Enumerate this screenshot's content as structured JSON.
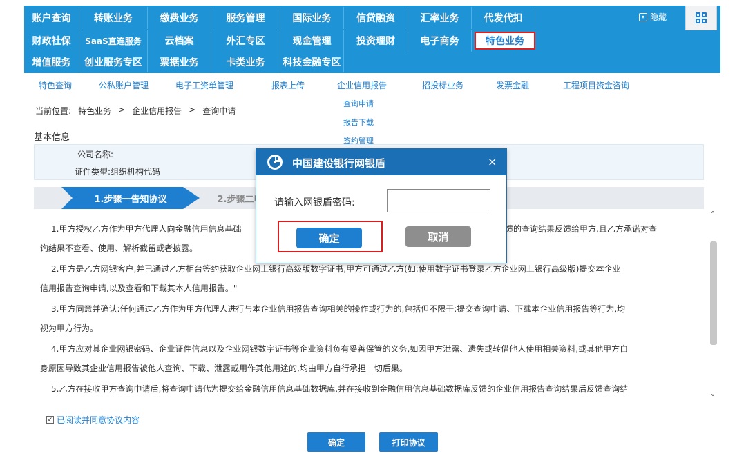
{
  "nav": {
    "row1": [
      "账户查询",
      "转账业务",
      "缴费业务",
      "服务管理",
      "国际业务",
      "信贷融资",
      "汇率业务",
      "代发代扣"
    ],
    "row2": [
      "财政社保",
      "SaaS直连服务",
      "云档案",
      "外汇专区",
      "现金管理",
      "投资理财",
      "电子商务",
      "特色业务"
    ],
    "row3": [
      "增值服务",
      "创业服务专区",
      "票据业务",
      "卡类业务",
      "科技金融专区"
    ],
    "hide_label": "隐藏",
    "hide_icon_glyph": "▾"
  },
  "subnav": {
    "items": [
      "特色查询",
      "公私账户管理",
      "电子工资单管理",
      "报表上传",
      "企业信用报告",
      "招投标业务",
      "发票金融",
      "工程项目资金咨询"
    ],
    "dropdown": [
      "查询申请",
      "报告下载",
      "签约管理"
    ]
  },
  "breadcrumb": {
    "prefix": "当前位置:",
    "level1": "特色业务",
    "sep": ">",
    "level2": "企业信用报告",
    "level3": "查询申请"
  },
  "basic_info": {
    "title": "基本信息",
    "company_label": "公司名称:",
    "cert_label": "证件类型:组织机构代码"
  },
  "steps": {
    "step1": "1.步骤一告知协议",
    "step2": "2.步骤二申请"
  },
  "agreement": {
    "p1a": "1.甲方授权乙方作为甲方代理人向金融信用信息基础",
    "p1b": "反馈的查询结果反馈给甲方,且乙方承诺对查",
    "p1c": "询结果不查看、使用、解析截留或者披露。",
    "p2a": "2.甲方是乙方网银客户,并已通过乙方柜台签约获取企业网上银行高级版数字证书,甲方可通过乙方(如:使用数字证书登录乙方企业网上银行高级版)提交本企业",
    "p2b": "信用报告查询申请,以及查看和下载其本人信用报告。\"",
    "p3a": "3.甲方同意并确认:任何通过乙方作为甲方代理人进行与本企业信用报告查询相关的操作或行为的,包括但不限于:提交查询申请、下载本企业信用报告等行为,均",
    "p3b": "视为甲方行为。",
    "p4a": "4.甲方应对其企业网银密码、企业证件信息以及企业网银数字证书等企业资料负有妥善保管的义务,如因甲方泄露、遗失或转借他人使用相关资料,或其他甲方自",
    "p4b": "身原因导致其企业信用报告被他人查询、下载、泄露或用作其他用途的,均由甲方自行承担一切后果。",
    "p5a": "5.乙方在接收甲方查询申请后,将查询申请代为提交给金融信用信息基础数据库,并在接收到金融信用信息基础数据库反馈的企业信用报告查询结果后反馈查询结"
  },
  "agree_checkbox": {
    "label": "已阅读并同意协议内容",
    "check_glyph": "✓"
  },
  "buttons": {
    "confirm": "确定",
    "print": "打印协议"
  },
  "scroll": {
    "up_glyph": "˄",
    "down_glyph": "˅"
  },
  "modal": {
    "title": "中国建设银行网银盾",
    "close_glyph": "×",
    "password_label": "请输入网银盾密码:",
    "password_value": "",
    "confirm": "确定",
    "cancel": "取消"
  },
  "colors": {
    "nav_blue": "#1e93d6",
    "link_blue": "#1e7fd0",
    "modal_header": "#1b6fb5",
    "highlight_red": "#e02020"
  }
}
